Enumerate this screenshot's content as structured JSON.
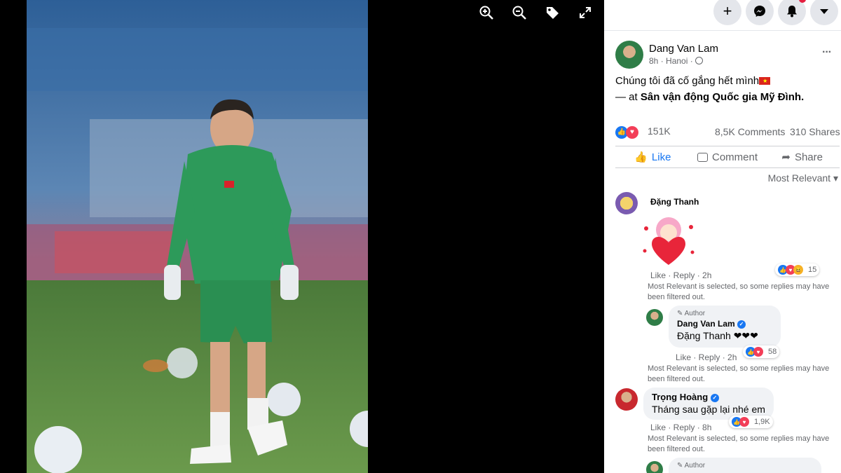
{
  "viewer": {
    "toolbar": [
      "zoom-in",
      "zoom-out",
      "tag",
      "fullscreen"
    ]
  },
  "topbar": {
    "notification_badge": ""
  },
  "post": {
    "author": "Dang Van Lam",
    "time": "8h",
    "location": "Hanoi",
    "separator": "·",
    "caption_line1": "Chúng tôi đã cố gắng hết mình",
    "caption_at": "— at",
    "caption_place": "Sân vận động Quốc gia Mỹ Đình.",
    "reactions_count": "151K",
    "comments_count": "8,5K Comments",
    "shares_count": "310 Shares",
    "more_icon": "···"
  },
  "actions": {
    "like": "Like",
    "comment": "Comment",
    "share": "Share"
  },
  "sort": {
    "label": "Most Relevant",
    "arrow": "▾"
  },
  "comments": [
    {
      "name": "Đặng Thanh",
      "links": "Like · Reply · 2h",
      "reaction_count": "15",
      "note": "Most Relevant is selected, so some replies may have been filtered out."
    },
    {
      "author_tag": "Author",
      "name": "Dang Van Lam",
      "text": "Đặng Thanh ❤❤❤",
      "links": "Like · Reply · 2h",
      "reaction_count": "58",
      "note": "Most Relevant is selected, so some replies may have been filtered out."
    },
    {
      "name": "Trọng Hoàng",
      "text": "Tháng sau gặp lại nhé em",
      "links": "Like · Reply · 8h",
      "reaction_count": "1,9K",
      "note": "Most Relevant is selected, so some replies may have been filtered out."
    },
    {
      "author_tag": "Author"
    }
  ],
  "colors": {
    "accent": "#1877f2",
    "love": "#f33e58",
    "text_secondary": "#65676b"
  }
}
